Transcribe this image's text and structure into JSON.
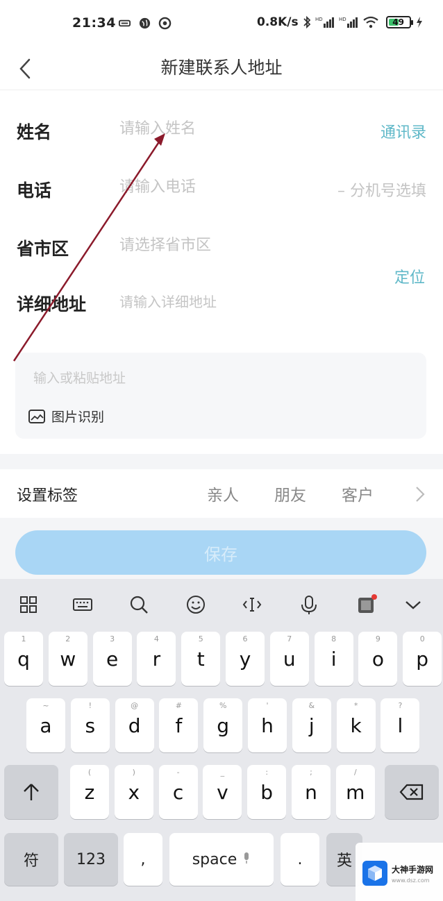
{
  "status_bar": {
    "time": "21:34",
    "net_speed": "0.8K/s",
    "battery": "49",
    "battery_level": 0.49
  },
  "nav": {
    "title": "新建联系人地址"
  },
  "form": {
    "name_label": "姓名",
    "name_placeholder": "请输入姓名",
    "contacts_action": "通讯录",
    "phone_label": "电话",
    "phone_placeholder": "请输入电话",
    "extension_placeholder": "– 分机号选填",
    "region_label": "省市区",
    "region_placeholder": "请选择省市区",
    "locate_action": "定位",
    "address_label": "详细地址",
    "address_placeholder": "请输入详细地址"
  },
  "paste": {
    "placeholder": "输入或粘贴地址",
    "image_recognition": "图片识别"
  },
  "tags": {
    "label": "设置标签",
    "items": [
      "亲人",
      "朋友",
      "客户"
    ]
  },
  "save": {
    "label": "保存"
  },
  "keyboard": {
    "row1": [
      {
        "main": "q",
        "sub": "1"
      },
      {
        "main": "w",
        "sub": "2"
      },
      {
        "main": "e",
        "sub": "3"
      },
      {
        "main": "r",
        "sub": "4"
      },
      {
        "main": "t",
        "sub": "5"
      },
      {
        "main": "y",
        "sub": "6"
      },
      {
        "main": "u",
        "sub": "7"
      },
      {
        "main": "i",
        "sub": "8"
      },
      {
        "main": "o",
        "sub": "9"
      },
      {
        "main": "p",
        "sub": "0"
      }
    ],
    "row2": [
      {
        "main": "a",
        "sub": "~"
      },
      {
        "main": "s",
        "sub": "!"
      },
      {
        "main": "d",
        "sub": "@"
      },
      {
        "main": "f",
        "sub": "#"
      },
      {
        "main": "g",
        "sub": "%"
      },
      {
        "main": "h",
        "sub": "'"
      },
      {
        "main": "j",
        "sub": "&"
      },
      {
        "main": "k",
        "sub": "*"
      },
      {
        "main": "l",
        "sub": "?"
      }
    ],
    "row3": [
      {
        "main": "z",
        "sub": "("
      },
      {
        "main": "x",
        "sub": ")"
      },
      {
        "main": "c",
        "sub": "-"
      },
      {
        "main": "v",
        "sub": "_"
      },
      {
        "main": "b",
        "sub": ":"
      },
      {
        "main": "n",
        "sub": ";"
      },
      {
        "main": "m",
        "sub": "/"
      }
    ],
    "symbol_key": "符",
    "numeric_key": "123",
    "comma_key": ",",
    "space_key": "space",
    "period_key": ".",
    "lang_key": "英"
  },
  "watermark": {
    "name": "大神手游网",
    "url": "www.dsz.com"
  },
  "colors": {
    "accent": "#5fb8c8",
    "save_button": "#a9d6f5",
    "annotation_arrow": "#8b1a2b"
  }
}
